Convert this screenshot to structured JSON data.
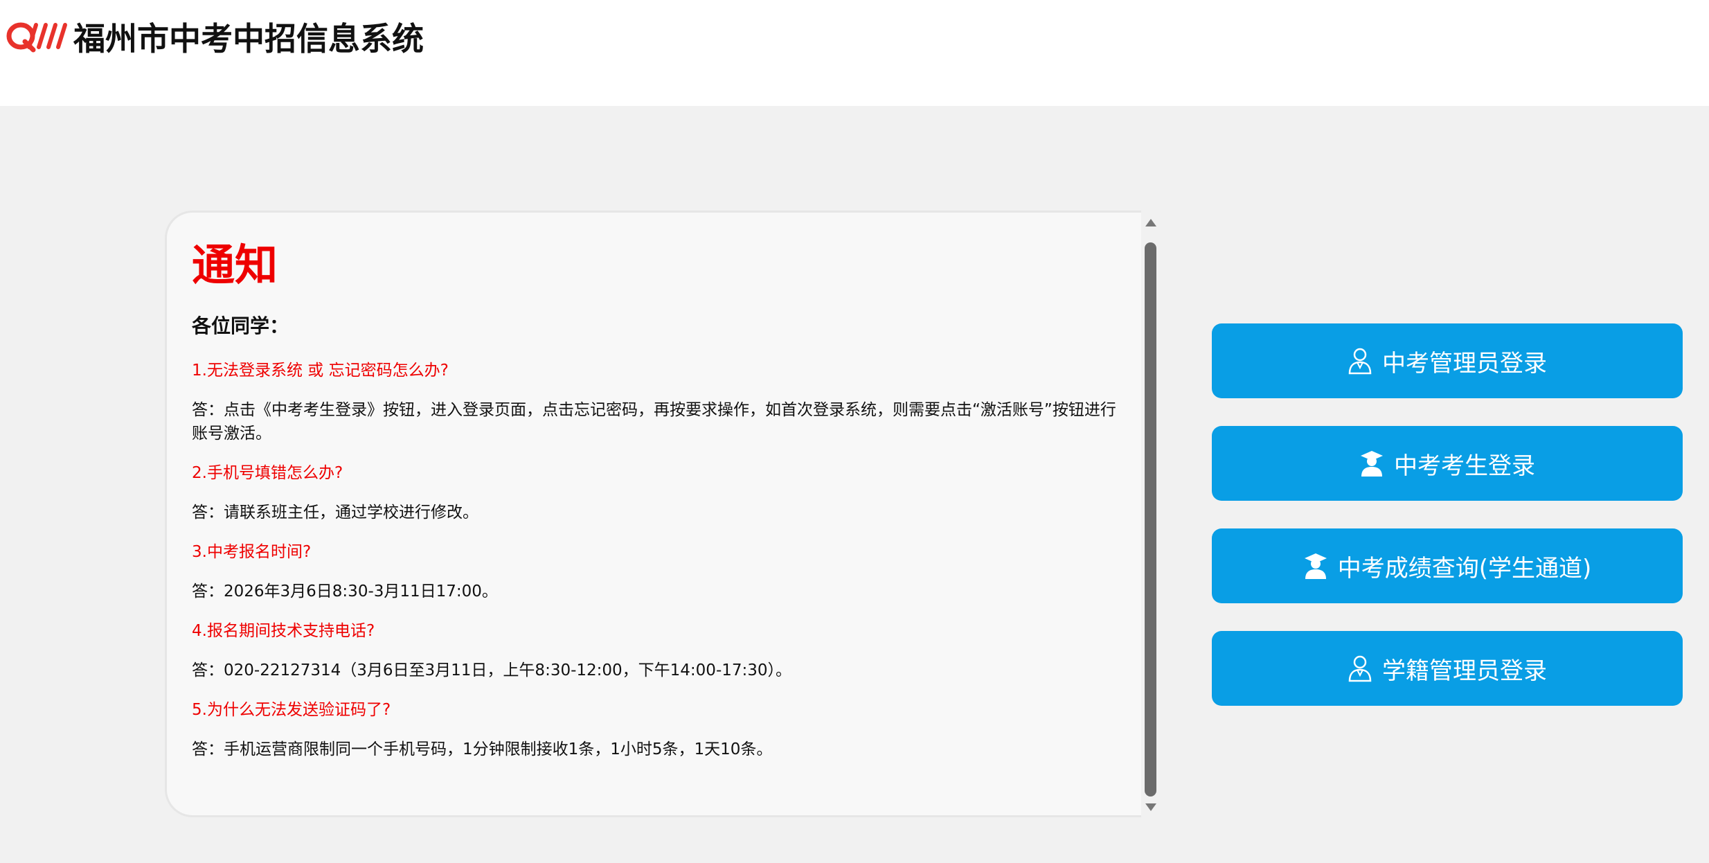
{
  "header": {
    "title": "福州市中考中招信息系统",
    "logo_icon": "qw-logo-icon",
    "logo_color": "#e8322b"
  },
  "notice": {
    "title": "通知",
    "greeting": "各位同学：",
    "qa": [
      {
        "q": "1.无法登录系统 或 忘记密码怎么办?",
        "a": "答：点击《中考考生登录》按钮，进入登录页面，点击忘记密码，再按要求操作，如首次登录系统，则需要点击“激活账号”按钮进行账号激活。"
      },
      {
        "q": "2.手机号填错怎么办?",
        "a": "答：请联系班主任，通过学校进行修改。"
      },
      {
        "q": "3.中考报名时间?",
        "a": "答：2026年3月6日8:30-3月11日17:00。"
      },
      {
        "q": "4.报名期间技术支持电话?",
        "a": "答：020-22127314（3月6日至3月11日，上午8:30-12:00，下午14:00-17:30）。"
      },
      {
        "q": "5.为什么无法发送验证码了?",
        "a": "答：手机运营商限制同一个手机号码，1分钟限制接收1条，1小时5条，1天10条。"
      }
    ],
    "title_color": "#ee0000",
    "question_color": "#ee0000"
  },
  "buttons": {
    "admin_login": "中考管理员登录",
    "student_login": "中考考生登录",
    "score_query": "中考成绩查询(学生通道)",
    "registry_admin_login": "学籍管理员登录",
    "color": "#099ee5"
  }
}
